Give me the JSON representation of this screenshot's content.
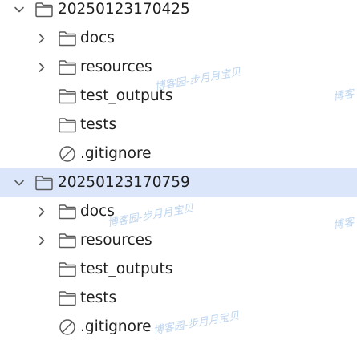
{
  "tree": {
    "rows": [
      {
        "label": "20250123170425",
        "icon": "folder-icon",
        "chevron": "chevron-down-icon"
      },
      {
        "label": "docs",
        "icon": "folder-icon",
        "chevron": "chevron-right-icon"
      },
      {
        "label": "resources",
        "icon": "folder-icon",
        "chevron": "chevron-right-icon"
      },
      {
        "label": "test_outputs",
        "icon": "folder-icon",
        "chevron": ""
      },
      {
        "label": "tests",
        "icon": "folder-icon",
        "chevron": ""
      },
      {
        "label": ".gitignore",
        "icon": "ignored-file-icon",
        "chevron": ""
      },
      {
        "label": "20250123170759",
        "icon": "folder-icon",
        "chevron": "chevron-down-icon",
        "selected": true
      },
      {
        "label": "docs",
        "icon": "folder-icon",
        "chevron": "chevron-right-icon"
      },
      {
        "label": "resources",
        "icon": "folder-icon",
        "chevron": "chevron-right-icon"
      },
      {
        "label": "test_outputs",
        "icon": "folder-icon",
        "chevron": ""
      },
      {
        "label": "tests",
        "icon": "folder-icon",
        "chevron": ""
      },
      {
        "label": ".gitignore",
        "icon": "ignored-file-icon",
        "chevron": ""
      }
    ]
  },
  "watermark": {
    "text": "博客园-步月月宝贝",
    "fragment": "博客"
  },
  "colors": {
    "selection": "#dbe6fb",
    "icon_stroke": "#5a5a5a",
    "watermark": "#a9c8ea"
  }
}
